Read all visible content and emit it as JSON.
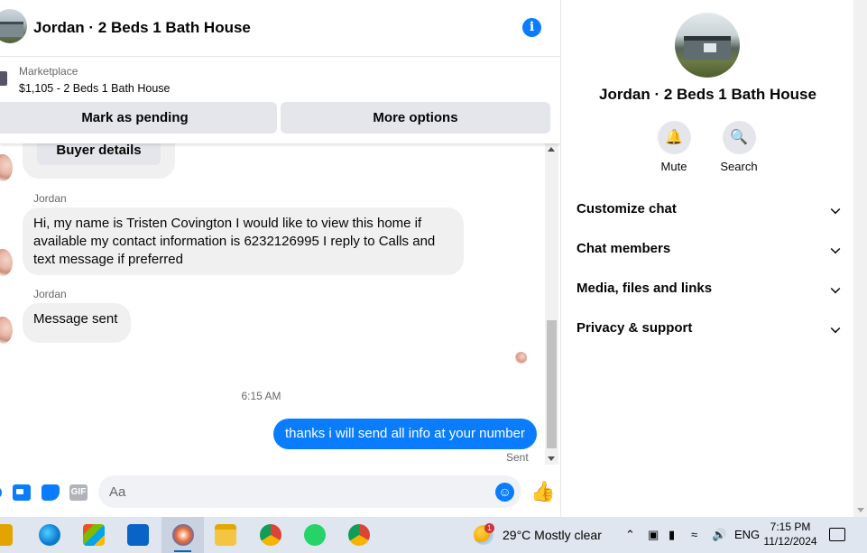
{
  "chat": {
    "title": "Jordan · 2 Beds 1 Bath House",
    "marketplace_label": "Marketplace",
    "listing": "$1,105 - 2 Beds 1 Bath House",
    "mark_pending_label": "Mark as pending",
    "more_options_label": "More options",
    "buyer_details_label": "Buyer details",
    "messages": [
      {
        "sender": "Jordan",
        "text": "Hi, my name is Tristen Covington I would like to view this home if available my contact information is 6232126995 I reply to Calls and text message if preferred"
      },
      {
        "sender": "Jordan",
        "text": "Message sent"
      }
    ],
    "timestamp": "6:15 AM",
    "outgoing": "thanks i will send all info at your number",
    "status": "Sent",
    "composer_placeholder": "Aa",
    "gif_label": "GIF"
  },
  "info_panel": {
    "name": "Jordan · 2 Beds 1 Bath House",
    "actions": [
      {
        "label": "Mute",
        "icon": "bell-icon"
      },
      {
        "label": "Search",
        "icon": "search-icon"
      }
    ],
    "sections": [
      "Customize chat",
      "Chat members",
      "Media, files and links",
      "Privacy & support"
    ]
  },
  "taskbar": {
    "weather_temp": "29°C",
    "weather_desc": "Mostly clear",
    "weather_badge": "1",
    "language": "ENG",
    "time": "7:15 PM",
    "date": "11/12/2024"
  },
  "colors": {
    "accent": "#0a7cff",
    "bubble_incoming": "#f0f0f0",
    "button_gray": "#e4e6eb"
  }
}
